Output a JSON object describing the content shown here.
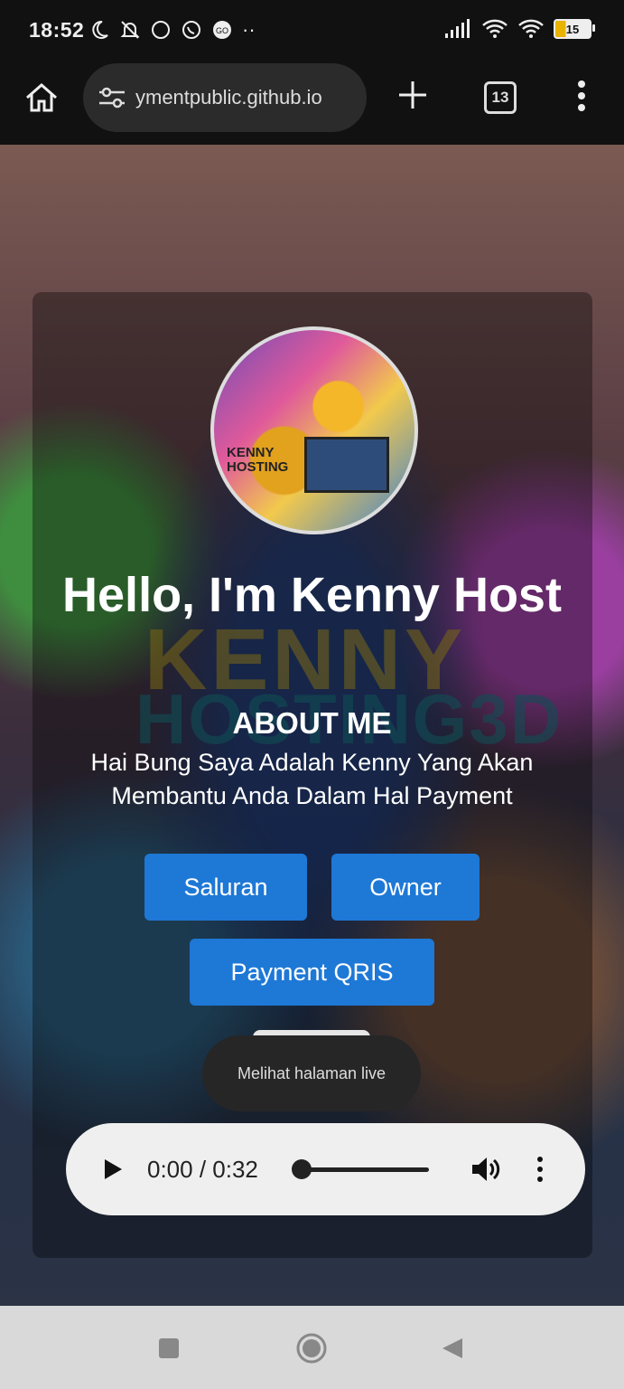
{
  "status_bar": {
    "time": "18:52",
    "battery": "15"
  },
  "browser": {
    "url": "ymentpublic.github.io",
    "tab_count": "13"
  },
  "page": {
    "background_text_1": "KENNY",
    "background_text_2": "HOSTING3D",
    "avatar_label": "KENNY HOSTING",
    "heading": "Hello, I'm Kenny Host",
    "about_title": "ABOUT ME",
    "about_text": "Hai Bung Saya Adalah Kenny Yang Akan Membantu Anda Dalam Hal Payment",
    "buttons": {
      "saluran": "Saluran",
      "owner": "Owner",
      "payment": "Payment QRIS"
    },
    "accent_color": "#1e78d6"
  },
  "toast": {
    "text": "Melihat halaman live"
  },
  "audio_player": {
    "time": "0:00 / 0:32",
    "progress": 0.0
  },
  "icons": {
    "home": "home-icon",
    "site_settings": "tune-icon",
    "new_tab": "plus-icon",
    "menu": "more-vert-icon",
    "nav_recent": "square-icon",
    "nav_home": "circle-icon",
    "nav_back": "triangle-back-icon"
  }
}
